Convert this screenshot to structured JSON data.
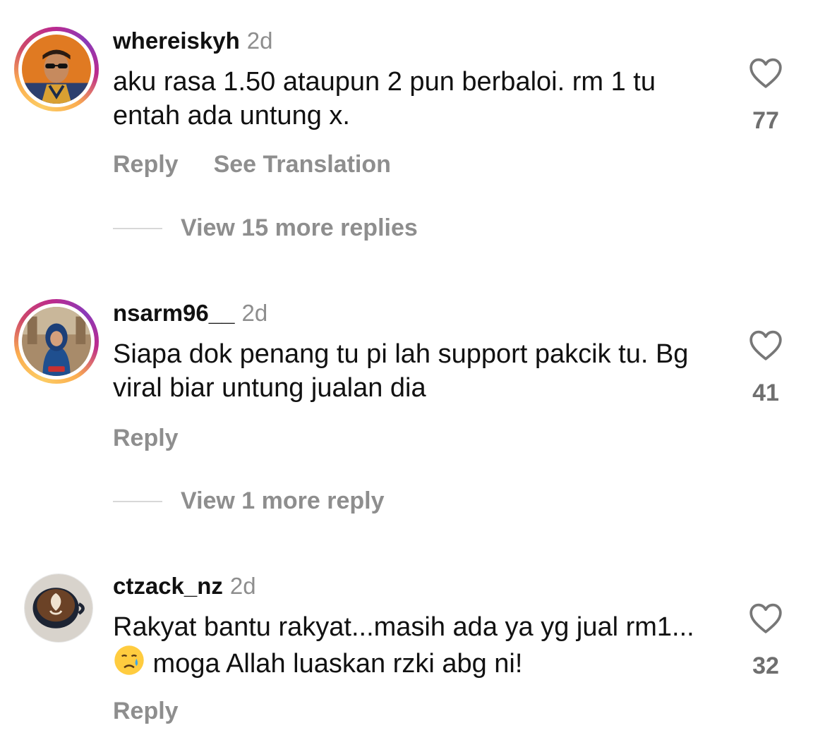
{
  "comments": [
    {
      "username": "whereiskyh",
      "time": "2d",
      "text": "aku rasa 1.50 ataupun 2 pun berbaloi. rm 1 tu entah ada untung x.",
      "likes": "77",
      "reply_label": "Reply",
      "translate_label": "See Translation",
      "view_replies": "View 15 more replies"
    },
    {
      "username": "nsarm96__",
      "time": "2d",
      "text": "Siapa dok penang tu pi lah support pakcik tu. Bg viral biar untung jualan dia",
      "likes": "41",
      "reply_label": "Reply",
      "view_replies": "View 1 more reply"
    },
    {
      "username": "ctzack_nz",
      "time": "2d",
      "text_part1": "Rakyat bantu rakyat...masih ada ya yg jual rm1...",
      "text_part2": " moga Allah luaskan rzki abg ni!",
      "likes": "32",
      "reply_label": "Reply"
    }
  ],
  "icons": {
    "like": "heart-outline-icon",
    "emoji": "crying-face-emoji"
  },
  "colors": {
    "secondary_text": "#8e8e8e",
    "story_ring": "#bc2a8d"
  }
}
